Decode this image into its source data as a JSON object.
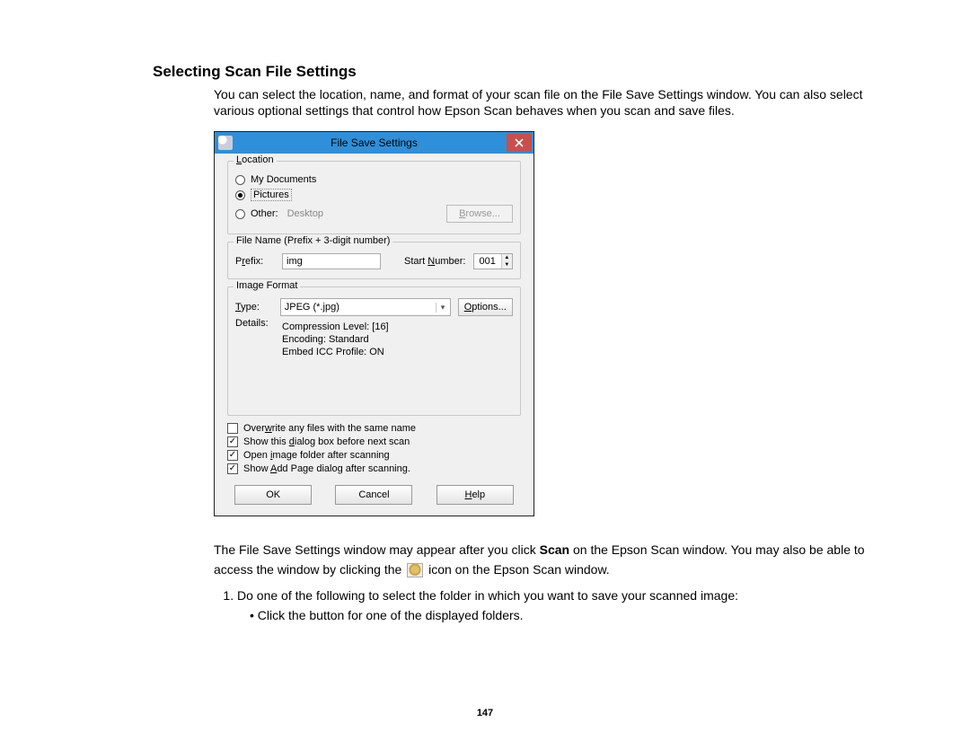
{
  "section_title": "Selecting Scan File Settings",
  "intro": "You can select the location, name, and format of your scan file on the File Save Settings window. You can also select various optional settings that control how Epson Scan behaves when you scan and save files.",
  "dialog": {
    "title": "File Save Settings",
    "location": {
      "label": "Location",
      "options": {
        "my_documents": "My Documents",
        "pictures": "Pictures",
        "other": "Other:"
      },
      "other_value": "Desktop",
      "browse": "Browse..."
    },
    "filename": {
      "label": "File Name (Prefix + 3-digit number)",
      "prefix_label": "Prefix:",
      "prefix_value": "img",
      "start_label": "Start Number:",
      "start_value": "001"
    },
    "image_format": {
      "label": "Image Format",
      "type_label": "Type:",
      "type_value": "JPEG (*.jpg)",
      "options_btn": "Options...",
      "details_label": "Details:",
      "details_lines": [
        "Compression Level: [16]",
        "Encoding: Standard",
        "Embed ICC Profile: ON"
      ]
    },
    "checks": {
      "overwrite": "Overwrite any files with the same name",
      "show_dialog": "Show this dialog box before next scan",
      "open_folder": "Open image folder after scanning",
      "show_add_page": "Show Add Page dialog after scanning."
    },
    "buttons": {
      "ok": "OK",
      "cancel": "Cancel",
      "help": "Help"
    }
  },
  "para2_a": "The File Save Settings window may appear after you click ",
  "para2_bold": "Scan",
  "para2_b": " on the Epson Scan window. You may also be able to access the window by clicking the ",
  "para2_c": " icon on the Epson Scan window.",
  "step1": "Do one of the following to select the folder in which you want to save your scanned image:",
  "bullet1": "Click the button for one of the displayed folders.",
  "page_number": "147"
}
